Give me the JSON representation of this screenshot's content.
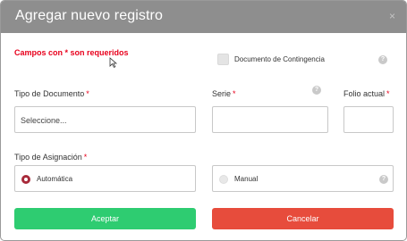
{
  "modal": {
    "title": "Agregar nuevo registro",
    "close_glyph": "×"
  },
  "form": {
    "required_note": "Campos con * son requeridos",
    "contingency_label": "Documento de Contingencia",
    "help_glyph": "?",
    "required_marker": "*",
    "tipo_documento": {
      "label": "Tipo de Documento",
      "value": "Seleccione..."
    },
    "serie": {
      "label": "Serie",
      "value": ""
    },
    "folio": {
      "label": "Folio actual",
      "value": ""
    },
    "tipo_asignacion": {
      "label": "Tipo de Asignación",
      "options": [
        {
          "label": "Automática",
          "selected": true
        },
        {
          "label": "Manual",
          "selected": false
        }
      ]
    }
  },
  "buttons": {
    "accept": "Aceptar",
    "cancel": "Cancelar"
  },
  "colors": {
    "header": "#8e8e8e",
    "required": "#e8001c",
    "accept": "#2ecc71",
    "cancel": "#e74c3c",
    "radio_selected": "#a82a3a"
  }
}
